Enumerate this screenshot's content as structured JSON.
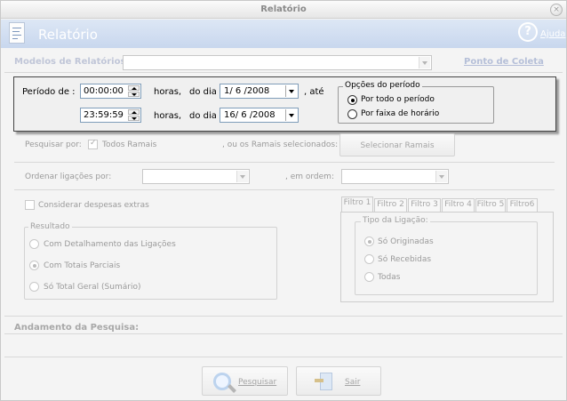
{
  "window": {
    "title": "Relatório",
    "close_glyph": "×"
  },
  "banner": {
    "title": "Relatório",
    "help_label": "Ajuda"
  },
  "models": {
    "label": "Modelos de Relatórios:",
    "value": "",
    "link": "Ponto de Coleta"
  },
  "period": {
    "label": "Período de :",
    "start_time": "00:00:00",
    "end_time": "23:59:59",
    "hours_label": "horas,",
    "day_label": "do dia",
    "start_date": "1/ 6 /2008",
    "end_date": "16/ 6 /2008",
    "until_label": ", até",
    "options_title": "Opções do período",
    "option_all": "Por todo o período",
    "option_range": "Por faixa de horário",
    "selected_option": "all"
  },
  "search": {
    "label": "Pesquisar por:",
    "all_extensions": "Todos Ramais",
    "all_extensions_checked": true,
    "or_selected": ", ou os Ramais selecionados:",
    "select_button": "Selecionar Ramais"
  },
  "order": {
    "label": "Ordenar ligações por:",
    "value": "",
    "order_label": ", em ordem:",
    "order_value": ""
  },
  "extras": {
    "label": "Considerar  despesas  extras",
    "checked": false
  },
  "result": {
    "title": "Resultado",
    "options": [
      "Com Detalhamento das Ligações",
      "Com Totais  Parciais",
      "Só Total  Geral (Sumário)"
    ],
    "selected_index": 1
  },
  "filters": {
    "tabs": [
      "Filtro 1",
      "Filtro 2",
      "Filtro 3",
      "Filtro 4",
      "Filtro 5",
      "Filtro6"
    ],
    "selected_tab": 0,
    "group_title": "Tipo da Ligação:",
    "options": [
      "Só Originadas",
      "Só Recebidas",
      "Todas"
    ],
    "selected_index": 0
  },
  "progress": {
    "label": "Andamento da Pesquisa:"
  },
  "actions": {
    "search_button": "Pesquisar",
    "exit_button": "Sair"
  },
  "icons": {
    "close": "close-icon",
    "help": "help-icon",
    "report": "document-icon",
    "search": "magnifier-icon",
    "exit": "exit-door-icon"
  },
  "colors": {
    "banner": "#c8d7ee",
    "panel_border": "#444444",
    "link": "#b5bfd8"
  }
}
